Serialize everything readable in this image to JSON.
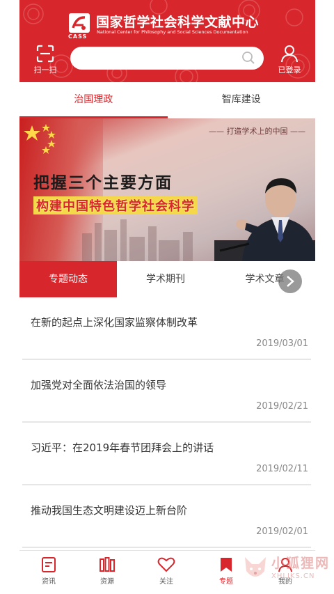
{
  "header": {
    "org_title": "国家哲学社会科学文献中心",
    "org_subtitle": "National Center for Philosophy and Social Sciences Documentation",
    "logo_text": "CASS",
    "scan_label": "扫一扫",
    "search_placeholder": "",
    "user_label": "已登录"
  },
  "top_tabs": [
    {
      "label": "治国理政",
      "active": true
    },
    {
      "label": "智库建设",
      "active": false
    }
  ],
  "banner": {
    "tagline": "—— 打造学术上的中国 ——",
    "title_line1": "把握三个主要方面",
    "title_line2": "构建中国特色哲学社会科学"
  },
  "sub_tabs": [
    {
      "label": "专题动态",
      "active": true
    },
    {
      "label": "学术期刊",
      "active": false
    },
    {
      "label": "学术文章",
      "active": false
    }
  ],
  "articles": [
    {
      "title": "在新的起点上深化国家监察体制改革",
      "date": "2019/03/01"
    },
    {
      "title": "加强党对全面依法治国的领导",
      "date": "2019/02/21"
    },
    {
      "title": "习近平：在2019年春节团拜会上的讲话",
      "date": "2019/02/11"
    },
    {
      "title": "推动我国生态文明建设迈上新台阶",
      "date": "2019/02/01"
    }
  ],
  "bottom_nav": [
    {
      "label": "资讯",
      "icon": "news-icon",
      "active": false
    },
    {
      "label": "资源",
      "icon": "books-icon",
      "active": false
    },
    {
      "label": "关注",
      "icon": "heart-icon",
      "active": false
    },
    {
      "label": "专题",
      "icon": "bookmark-icon",
      "active": true
    },
    {
      "label": "我的",
      "icon": "profile-icon",
      "active": false
    }
  ],
  "watermark": {
    "title": "小狐狸网",
    "url": "XHLIKS.CN"
  },
  "colors": {
    "brand_red": "#d8272c",
    "text": "#333333",
    "muted": "#888888"
  }
}
